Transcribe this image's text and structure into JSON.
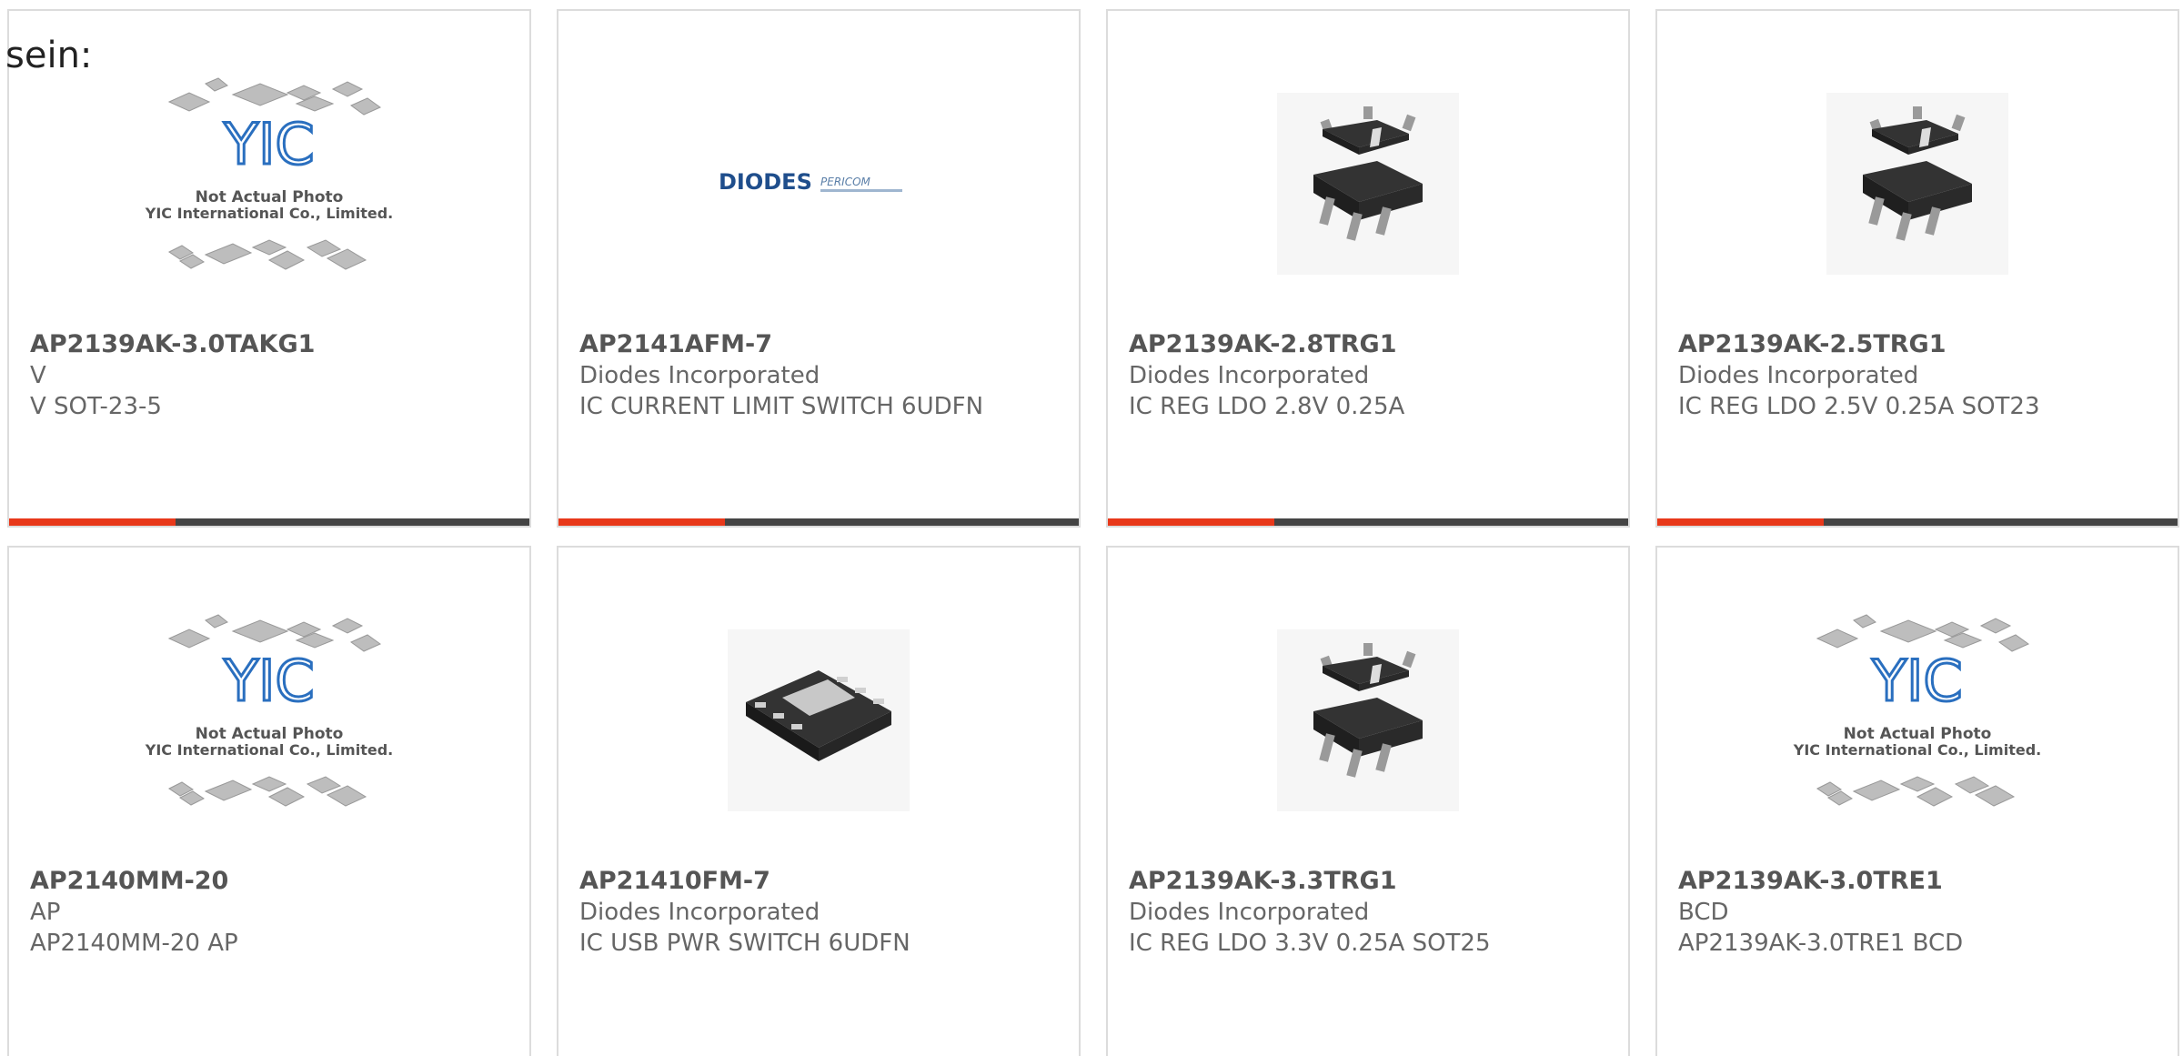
{
  "intro_text": "sein:",
  "placeholder_photo": {
    "line1": "Not Actual Photo",
    "line2": "YIC International Co., Limited.",
    "logo": "YIC"
  },
  "diodes_logo": {
    "brand": "DIODES",
    "sub": "PERICOM"
  },
  "accent_colors": {
    "red": "#e8381a",
    "dark": "#444444"
  },
  "products": [
    {
      "part": "AP2139AK-3.0TAKG1",
      "manufacturer": "V",
      "description": "V SOT-23-5",
      "image": "placeholder"
    },
    {
      "part": "AP2141AFM-7",
      "manufacturer": "Diodes Incorporated",
      "description": "IC CURRENT LIMIT SWITCH 6UDFN",
      "image": "diodes-logo"
    },
    {
      "part": "AP2139AK-2.8TRG1",
      "manufacturer": "Diodes Incorporated",
      "description": "IC REG LDO 2.8V 0.25A",
      "image": "sot23"
    },
    {
      "part": "AP2139AK-2.5TRG1",
      "manufacturer": "Diodes Incorporated",
      "description": "IC REG LDO 2.5V 0.25A SOT23",
      "image": "sot23"
    },
    {
      "part": "AP2140MM-20",
      "manufacturer": "AP",
      "description": "AP2140MM-20 AP",
      "image": "placeholder"
    },
    {
      "part": "AP21410FM-7",
      "manufacturer": "Diodes Incorporated",
      "description": "IC USB PWR SWITCH 6UDFN",
      "image": "udfn"
    },
    {
      "part": "AP2139AK-3.3TRG1",
      "manufacturer": "Diodes Incorporated",
      "description": "IC REG LDO 3.3V 0.25A SOT25",
      "image": "sot23"
    },
    {
      "part": "AP2139AK-3.0TRE1",
      "manufacturer": "BCD",
      "description": "AP2139AK-3.0TRE1 BCD",
      "image": "placeholder"
    }
  ]
}
